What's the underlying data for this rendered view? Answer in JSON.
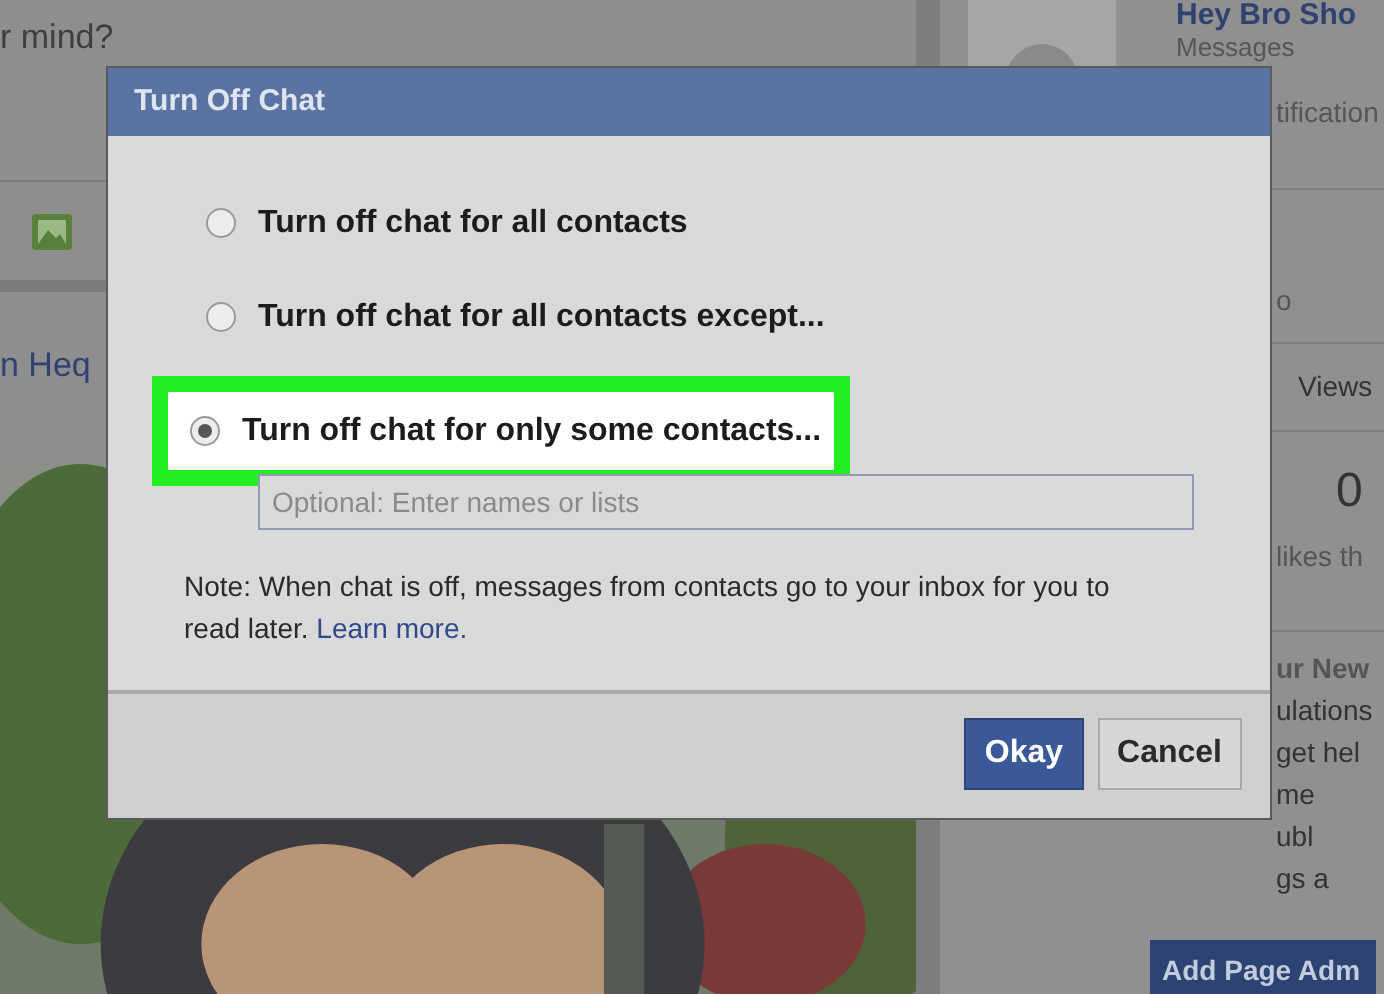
{
  "background": {
    "composer_prompt": "r mind?",
    "post_author": "n Heq",
    "sidebar": {
      "page_name": "Hey Bro Sho",
      "messages": "Messages",
      "notifications": "tification",
      "item_3": "o",
      "stats_header": "Views",
      "stat_value": "0",
      "stat_label": "likes th",
      "section_title": "ur New",
      "section_lines": [
        "ulations",
        "get hel",
        "me",
        "ubl",
        "gs a"
      ],
      "admin_button": "Add Page Adm"
    }
  },
  "dialog": {
    "title": "Turn Off Chat",
    "options": [
      {
        "label": "Turn off chat for all contacts",
        "selected": false,
        "highlighted": false
      },
      {
        "label": "Turn off chat for all contacts except...",
        "selected": false,
        "highlighted": false
      },
      {
        "label": "Turn off chat for only some contacts...",
        "selected": true,
        "highlighted": true
      }
    ],
    "names_field": {
      "placeholder": "Optional: Enter names or lists"
    },
    "note": "Note: When chat is off, messages from contacts go to your inbox for you to read later.",
    "learn_more": "Learn more.",
    "buttons": [
      {
        "label": "Okay",
        "kind": "primary"
      },
      {
        "label": "Cancel",
        "kind": "secondary"
      }
    ]
  }
}
